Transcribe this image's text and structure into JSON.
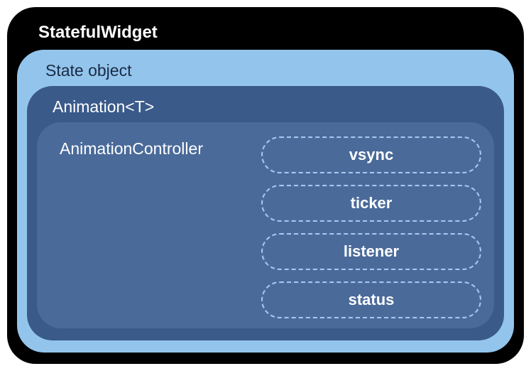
{
  "outer": {
    "title": "StatefulWidget"
  },
  "state": {
    "title": "State object"
  },
  "animation": {
    "title": "Animation<T>"
  },
  "controller": {
    "title": "AnimationController",
    "items": [
      "vsync",
      "ticker",
      "listener",
      "status"
    ]
  }
}
